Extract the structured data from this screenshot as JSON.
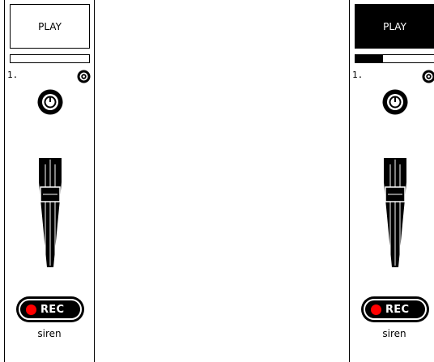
{
  "channels": [
    {
      "play_label": "PLAY",
      "playing": false,
      "progress": 0,
      "track_number": "1.",
      "rec_label": "REC",
      "name": "siren"
    },
    {
      "play_label": "PLAY",
      "playing": true,
      "progress": 0.35,
      "track_number": "1.",
      "rec_label": "REC",
      "name": "siren"
    }
  ],
  "colors": {
    "rec_dot": "#ff0000",
    "panel_fg": "#000000",
    "panel_bg": "#ffffff"
  }
}
